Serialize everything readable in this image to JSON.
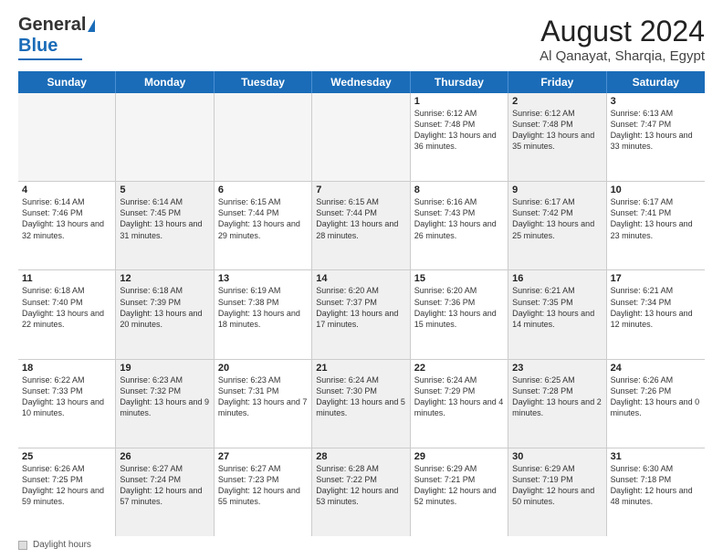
{
  "header": {
    "logo_general": "General",
    "logo_blue": "Blue",
    "main_title": "August 2024",
    "subtitle": "Al Qanayat, Sharqia, Egypt"
  },
  "calendar": {
    "days_of_week": [
      "Sunday",
      "Monday",
      "Tuesday",
      "Wednesday",
      "Thursday",
      "Friday",
      "Saturday"
    ],
    "rows": [
      {
        "cells": [
          {
            "day": "",
            "text": "",
            "empty": true
          },
          {
            "day": "",
            "text": "",
            "empty": true
          },
          {
            "day": "",
            "text": "",
            "empty": true
          },
          {
            "day": "",
            "text": "",
            "empty": true
          },
          {
            "day": "1",
            "text": "Sunrise: 6:12 AM\nSunset: 7:48 PM\nDaylight: 13 hours and 36 minutes.",
            "shaded": false
          },
          {
            "day": "2",
            "text": "Sunrise: 6:12 AM\nSunset: 7:48 PM\nDaylight: 13 hours and 35 minutes.",
            "shaded": true
          },
          {
            "day": "3",
            "text": "Sunrise: 6:13 AM\nSunset: 7:47 PM\nDaylight: 13 hours and 33 minutes.",
            "shaded": false
          }
        ]
      },
      {
        "cells": [
          {
            "day": "4",
            "text": "Sunrise: 6:14 AM\nSunset: 7:46 PM\nDaylight: 13 hours and 32 minutes.",
            "shaded": false
          },
          {
            "day": "5",
            "text": "Sunrise: 6:14 AM\nSunset: 7:45 PM\nDaylight: 13 hours and 31 minutes.",
            "shaded": true
          },
          {
            "day": "6",
            "text": "Sunrise: 6:15 AM\nSunset: 7:44 PM\nDaylight: 13 hours and 29 minutes.",
            "shaded": false
          },
          {
            "day": "7",
            "text": "Sunrise: 6:15 AM\nSunset: 7:44 PM\nDaylight: 13 hours and 28 minutes.",
            "shaded": true
          },
          {
            "day": "8",
            "text": "Sunrise: 6:16 AM\nSunset: 7:43 PM\nDaylight: 13 hours and 26 minutes.",
            "shaded": false
          },
          {
            "day": "9",
            "text": "Sunrise: 6:17 AM\nSunset: 7:42 PM\nDaylight: 13 hours and 25 minutes.",
            "shaded": true
          },
          {
            "day": "10",
            "text": "Sunrise: 6:17 AM\nSunset: 7:41 PM\nDaylight: 13 hours and 23 minutes.",
            "shaded": false
          }
        ]
      },
      {
        "cells": [
          {
            "day": "11",
            "text": "Sunrise: 6:18 AM\nSunset: 7:40 PM\nDaylight: 13 hours and 22 minutes.",
            "shaded": false
          },
          {
            "day": "12",
            "text": "Sunrise: 6:18 AM\nSunset: 7:39 PM\nDaylight: 13 hours and 20 minutes.",
            "shaded": true
          },
          {
            "day": "13",
            "text": "Sunrise: 6:19 AM\nSunset: 7:38 PM\nDaylight: 13 hours and 18 minutes.",
            "shaded": false
          },
          {
            "day": "14",
            "text": "Sunrise: 6:20 AM\nSunset: 7:37 PM\nDaylight: 13 hours and 17 minutes.",
            "shaded": true
          },
          {
            "day": "15",
            "text": "Sunrise: 6:20 AM\nSunset: 7:36 PM\nDaylight: 13 hours and 15 minutes.",
            "shaded": false
          },
          {
            "day": "16",
            "text": "Sunrise: 6:21 AM\nSunset: 7:35 PM\nDaylight: 13 hours and 14 minutes.",
            "shaded": true
          },
          {
            "day": "17",
            "text": "Sunrise: 6:21 AM\nSunset: 7:34 PM\nDaylight: 13 hours and 12 minutes.",
            "shaded": false
          }
        ]
      },
      {
        "cells": [
          {
            "day": "18",
            "text": "Sunrise: 6:22 AM\nSunset: 7:33 PM\nDaylight: 13 hours and 10 minutes.",
            "shaded": false
          },
          {
            "day": "19",
            "text": "Sunrise: 6:23 AM\nSunset: 7:32 PM\nDaylight: 13 hours and 9 minutes.",
            "shaded": true
          },
          {
            "day": "20",
            "text": "Sunrise: 6:23 AM\nSunset: 7:31 PM\nDaylight: 13 hours and 7 minutes.",
            "shaded": false
          },
          {
            "day": "21",
            "text": "Sunrise: 6:24 AM\nSunset: 7:30 PM\nDaylight: 13 hours and 5 minutes.",
            "shaded": true
          },
          {
            "day": "22",
            "text": "Sunrise: 6:24 AM\nSunset: 7:29 PM\nDaylight: 13 hours and 4 minutes.",
            "shaded": false
          },
          {
            "day": "23",
            "text": "Sunrise: 6:25 AM\nSunset: 7:28 PM\nDaylight: 13 hours and 2 minutes.",
            "shaded": true
          },
          {
            "day": "24",
            "text": "Sunrise: 6:26 AM\nSunset: 7:26 PM\nDaylight: 13 hours and 0 minutes.",
            "shaded": false
          }
        ]
      },
      {
        "cells": [
          {
            "day": "25",
            "text": "Sunrise: 6:26 AM\nSunset: 7:25 PM\nDaylight: 12 hours and 59 minutes.",
            "shaded": false
          },
          {
            "day": "26",
            "text": "Sunrise: 6:27 AM\nSunset: 7:24 PM\nDaylight: 12 hours and 57 minutes.",
            "shaded": true
          },
          {
            "day": "27",
            "text": "Sunrise: 6:27 AM\nSunset: 7:23 PM\nDaylight: 12 hours and 55 minutes.",
            "shaded": false
          },
          {
            "day": "28",
            "text": "Sunrise: 6:28 AM\nSunset: 7:22 PM\nDaylight: 12 hours and 53 minutes.",
            "shaded": true
          },
          {
            "day": "29",
            "text": "Sunrise: 6:29 AM\nSunset: 7:21 PM\nDaylight: 12 hours and 52 minutes.",
            "shaded": false
          },
          {
            "day": "30",
            "text": "Sunrise: 6:29 AM\nSunset: 7:19 PM\nDaylight: 12 hours and 50 minutes.",
            "shaded": true
          },
          {
            "day": "31",
            "text": "Sunrise: 6:30 AM\nSunset: 7:18 PM\nDaylight: 12 hours and 48 minutes.",
            "shaded": false
          }
        ]
      }
    ]
  },
  "footer": {
    "daylight_label": "Daylight hours"
  }
}
